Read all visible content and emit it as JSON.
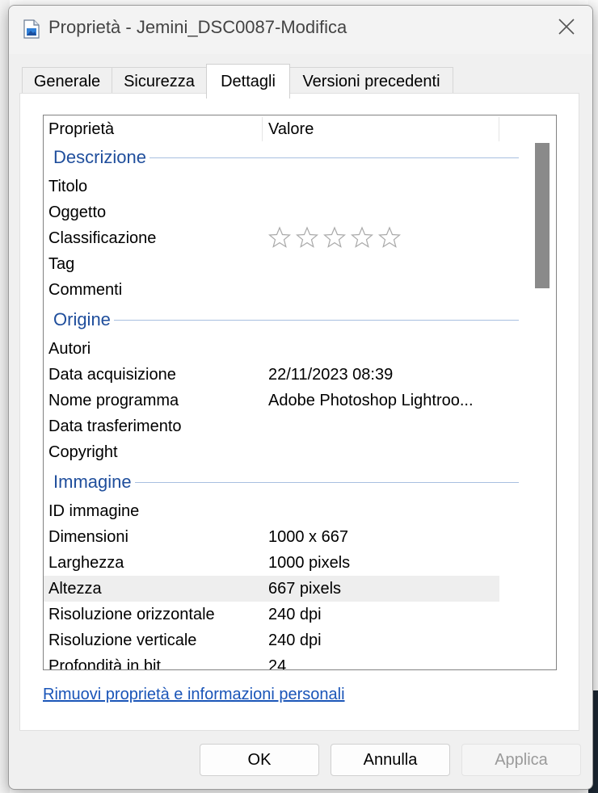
{
  "window": {
    "title": "Proprietà - Jemini_DSC0087-Modifica"
  },
  "tabs": [
    {
      "label": "Generale"
    },
    {
      "label": "Sicurezza"
    },
    {
      "label": "Dettagli"
    },
    {
      "label": "Versioni precedenti"
    }
  ],
  "active_tab": "Dettagli",
  "list": {
    "col_property": "Proprietà",
    "col_value": "Valore",
    "groups": [
      {
        "title": "Descrizione",
        "rows": [
          {
            "name": "Titolo",
            "value": ""
          },
          {
            "name": "Oggetto",
            "value": ""
          },
          {
            "name": "Classificazione",
            "value": "",
            "rating_stars_total": 5,
            "rating_stars_filled": 0
          },
          {
            "name": "Tag",
            "value": ""
          },
          {
            "name": "Commenti",
            "value": ""
          }
        ]
      },
      {
        "title": "Origine",
        "rows": [
          {
            "name": "Autori",
            "value": ""
          },
          {
            "name": "Data acquisizione",
            "value": "22/11/2023 08:39"
          },
          {
            "name": "Nome programma",
            "value": "Adobe Photoshop Lightroo..."
          },
          {
            "name": "Data trasferimento",
            "value": ""
          },
          {
            "name": "Copyright",
            "value": ""
          }
        ]
      },
      {
        "title": "Immagine",
        "rows": [
          {
            "name": "ID immagine",
            "value": ""
          },
          {
            "name": "Dimensioni",
            "value": "1000 x 667"
          },
          {
            "name": "Larghezza",
            "value": "1000 pixels"
          },
          {
            "name": "Altezza",
            "value": "667 pixels",
            "selected": true
          },
          {
            "name": "Risoluzione orizzontale",
            "value": "240 dpi"
          },
          {
            "name": "Risoluzione verticale",
            "value": "240 dpi"
          },
          {
            "name": "Profondità in bit",
            "value": "24"
          }
        ]
      }
    ]
  },
  "link_remove": "Rimuovi proprietà e informazioni personali",
  "buttons": {
    "ok": "OK",
    "cancel": "Annulla",
    "apply": "Applica"
  },
  "colors": {
    "group_title": "#1f4e9c",
    "link": "#1a55b8"
  }
}
